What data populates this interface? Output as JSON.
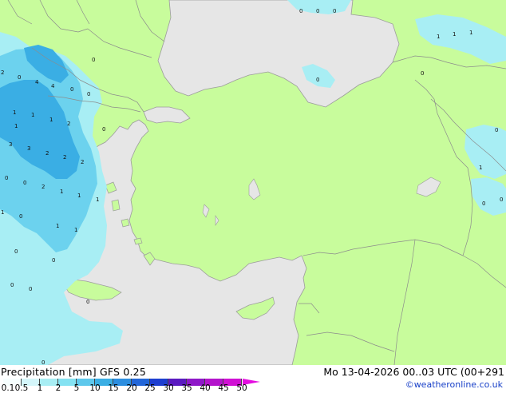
{
  "map": {
    "colors": {
      "land": "#c8fc9c",
      "sea": "#e6e6e6",
      "precip_light": "#a8eef4",
      "precip_mid": "#6cd2ee",
      "precip_heavy": "#3aaee4",
      "border": "#909090",
      "coast": "#a0a0a0"
    },
    "labels": [
      {
        "id": "t1",
        "text": "0"
      },
      {
        "id": "t2",
        "text": "0"
      },
      {
        "id": "t3",
        "text": "0"
      },
      {
        "id": "t4",
        "text": "1"
      },
      {
        "id": "t5",
        "text": "1"
      },
      {
        "id": "t6",
        "text": "1"
      },
      {
        "id": "t7",
        "text": "0"
      },
      {
        "id": "t8",
        "text": "0"
      },
      {
        "id": "t9",
        "text": "0"
      },
      {
        "id": "t10",
        "text": "0"
      },
      {
        "id": "t11",
        "text": "0"
      },
      {
        "id": "t12",
        "text": "1"
      },
      {
        "id": "t13",
        "text": "1"
      },
      {
        "id": "t14",
        "text": "0"
      },
      {
        "id": "t15",
        "text": "2"
      },
      {
        "id": "t16",
        "text": "0"
      },
      {
        "id": "t17",
        "text": "4"
      },
      {
        "id": "t18",
        "text": "4"
      },
      {
        "id": "t19",
        "text": "0"
      },
      {
        "id": "t20",
        "text": "0"
      },
      {
        "id": "t21",
        "text": "1"
      },
      {
        "id": "t22",
        "text": "1"
      },
      {
        "id": "t23",
        "text": "1"
      },
      {
        "id": "t24",
        "text": "2"
      },
      {
        "id": "t25",
        "text": "0"
      },
      {
        "id": "t26",
        "text": "3"
      },
      {
        "id": "t27",
        "text": "3"
      },
      {
        "id": "t28",
        "text": "2"
      },
      {
        "id": "t29",
        "text": "2"
      },
      {
        "id": "t30",
        "text": "2"
      },
      {
        "id": "t31",
        "text": "0"
      },
      {
        "id": "t32",
        "text": "0"
      },
      {
        "id": "t33",
        "text": "2"
      },
      {
        "id": "t34",
        "text": "1"
      },
      {
        "id": "t35",
        "text": "1"
      },
      {
        "id": "t36",
        "text": "1"
      },
      {
        "id": "t37",
        "text": "1"
      },
      {
        "id": "t38",
        "text": "0"
      },
      {
        "id": "t39",
        "text": "1"
      },
      {
        "id": "t40",
        "text": "1"
      },
      {
        "id": "t41",
        "text": "0"
      },
      {
        "id": "t42",
        "text": "0"
      },
      {
        "id": "t43",
        "text": "0"
      },
      {
        "id": "t44",
        "text": "0"
      },
      {
        "id": "t45",
        "text": "0"
      },
      {
        "id": "t46",
        "text": "0"
      }
    ]
  },
  "footer": {
    "title": "Precipitation [mm] GFS 0.25",
    "datetime": "Mo 13-04-2026 00..03 UTC (00+291",
    "credit": "©weatheronline.co.uk",
    "scale": {
      "ticks": [
        "0.1",
        "0.5",
        "1",
        "2",
        "5",
        "10",
        "15",
        "20",
        "25",
        "30",
        "35",
        "40",
        "45",
        "50"
      ],
      "colors": [
        "#f6fefe",
        "#d4f6fa",
        "#a8eef4",
        "#84e2f2",
        "#5ec8ec",
        "#3aaee4",
        "#2c8ee0",
        "#2266d8",
        "#1d3ed0",
        "#5a1ac0",
        "#8e18c8",
        "#b414cc",
        "#d010d4"
      ],
      "tip_color": "#e40ee0"
    }
  }
}
